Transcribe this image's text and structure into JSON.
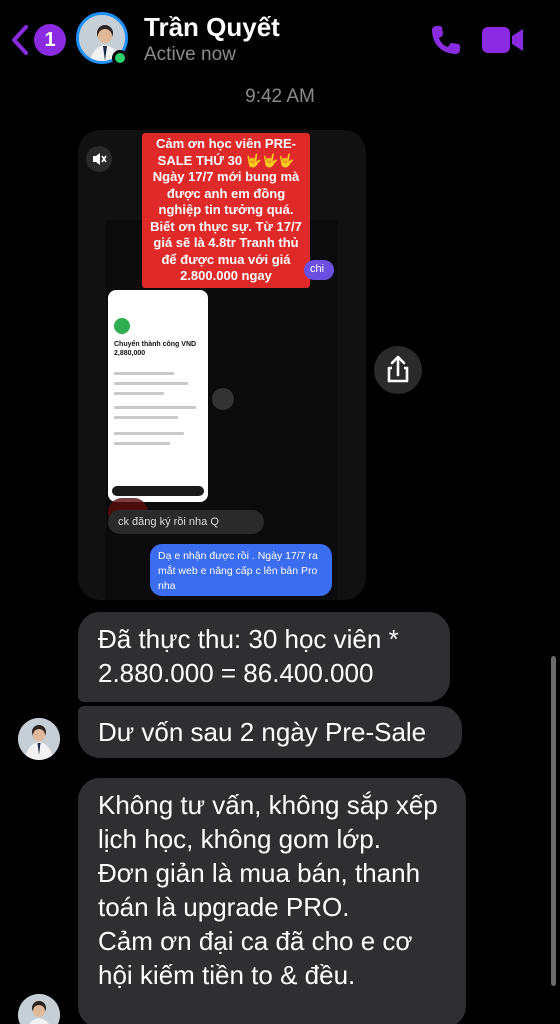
{
  "header": {
    "back_badge": "1",
    "contact_name": "Trần Quyết",
    "status": "Active now",
    "icons": [
      "back-chevron-icon",
      "phone-icon",
      "video-camera-icon"
    ],
    "accent_color": "#8a2be2"
  },
  "conversation": {
    "timestamp": "9:42 AM",
    "media": {
      "caption": "Cảm ơn học viên PRE-SALE THỨ 30 🤟🤟🤟 Ngày 17/7 mới bung mà được anh em đồng nghiệp tin tưởng quá. Biết ơn thực sự. Từ 17/7 giá sẽ là 4.8tr Tranh thủ để được mua với giá 2.800.000 ngay",
      "inner_card_title": "Chuyển thành công VND 2,880,000",
      "inner_gray_bubble": "ck đăng ký rồi nha Q",
      "inner_blue_bubble": "Dạ e nhận được rồi . Ngày 17/7 ra mắt web e nâng cấp c lên bản Pro nha",
      "inner_purple_snippet": "chi"
    },
    "messages": [
      {
        "text": "Đã thực thu: 30 học viên * 2.880.000 = 86.400.000"
      },
      {
        "text": "Dư vốn sau 2 ngày Pre-Sale"
      },
      {
        "text": "Không tư vấn, không sắp xếp lịch học, không gom lớp.\nĐơn giản là mua bán, thanh toán là upgrade PRO.\nCảm ơn đại ca đã cho e cơ hội kiếm tiền to & đều."
      }
    ]
  }
}
